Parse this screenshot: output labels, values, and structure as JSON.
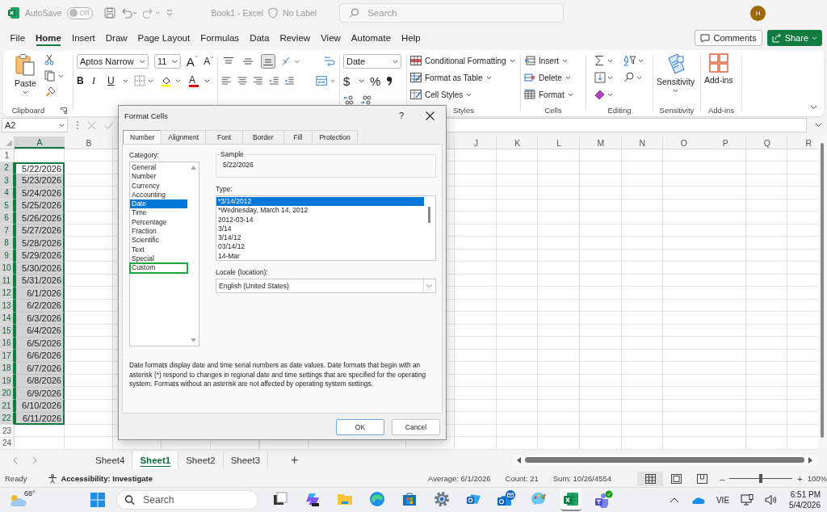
{
  "title_bar": {
    "autosave_label": "AutoSave",
    "autosave": {
      "on": false,
      "state_label": "Off"
    },
    "document_title": "Book1 - Excel",
    "sensitivity_label": "No Label",
    "search_placeholder": "Search",
    "avatar_initial": "H"
  },
  "menu_tabs": [
    {
      "label": "File",
      "selected": false
    },
    {
      "label": "Home",
      "selected": true
    },
    {
      "label": "Insert",
      "selected": false
    },
    {
      "label": "Draw",
      "selected": false
    },
    {
      "label": "Page Layout",
      "selected": false
    },
    {
      "label": "Formulas",
      "selected": false
    },
    {
      "label": "Data",
      "selected": false
    },
    {
      "label": "Review",
      "selected": false
    },
    {
      "label": "View",
      "selected": false
    },
    {
      "label": "Automate",
      "selected": false
    },
    {
      "label": "Help",
      "selected": false
    }
  ],
  "comments_button": "Comments",
  "share_button": "Share",
  "ribbon": {
    "clipboard": {
      "paste_label": "Paste",
      "group_label": "Clipboard"
    },
    "font": {
      "font_name": "Aptos Narrow",
      "font_size": "11",
      "grow_glyph": "A",
      "shrink_glyph": "A",
      "bold": "B",
      "italic": "I",
      "underline": "U",
      "font_color_glyph": "A"
    },
    "vertical_align": [
      {
        "kind": "top",
        "selected": false
      },
      {
        "kind": "middle",
        "selected": false
      },
      {
        "kind": "bottom",
        "selected": true
      }
    ],
    "number": {
      "format": "Date",
      "currency_glyph": "$",
      "percent_glyph": "%"
    },
    "styles": {
      "items": [
        {
          "kind": "conditional",
          "label": "Conditional Formatting"
        },
        {
          "kind": "table",
          "label": "Format as Table"
        },
        {
          "kind": "cell_styles",
          "label": "Cell Styles"
        }
      ],
      "group_label": "Styles"
    },
    "cells": {
      "items": [
        {
          "kind": "insert",
          "label": "Insert"
        },
        {
          "kind": "delete",
          "label": "Delete"
        },
        {
          "kind": "format",
          "label": "Format"
        }
      ],
      "group_label": "Cells"
    },
    "editing": {
      "group_label": "Editing"
    },
    "sensitivity": {
      "label": "Sensitivity",
      "group_label": "Sensitivity"
    },
    "addins": {
      "label": "Add-ins",
      "group_label": "Add-ins"
    }
  },
  "formula_bar": {
    "name_box": "A2"
  },
  "sheet": {
    "columns": [
      {
        "label": "A",
        "selected": true
      },
      {
        "label": "B",
        "selected": false
      },
      {
        "label": "J",
        "selected": false
      },
      {
        "label": "K",
        "selected": false
      },
      {
        "label": "L",
        "selected": false
      },
      {
        "label": "M",
        "selected": false
      },
      {
        "label": "N",
        "selected": false
      },
      {
        "label": "O",
        "selected": false
      },
      {
        "label": "P",
        "selected": false
      },
      {
        "label": "Q",
        "selected": false
      },
      {
        "label": "R",
        "selected": false
      }
    ],
    "rows": [
      {
        "number": "1",
        "selected": false
      },
      {
        "number": "2",
        "selected": true,
        "active": true,
        "value": "5/22/2026"
      },
      {
        "number": "3",
        "selected": true,
        "active": false,
        "value": "5/23/2026"
      },
      {
        "number": "4",
        "selected": true,
        "active": false,
        "value": "5/24/2026"
      },
      {
        "number": "5",
        "selected": true,
        "active": false,
        "value": "5/25/2026"
      },
      {
        "number": "6",
        "selected": true,
        "active": false,
        "value": "5/26/2026"
      },
      {
        "number": "7",
        "selected": true,
        "active": false,
        "value": "5/27/2026"
      },
      {
        "number": "8",
        "selected": true,
        "active": false,
        "value": "5/28/2026"
      },
      {
        "number": "9",
        "selected": true,
        "active": false,
        "value": "5/29/2026"
      },
      {
        "number": "10",
        "selected": true,
        "active": false,
        "value": "5/30/2026"
      },
      {
        "number": "11",
        "selected": true,
        "active": false,
        "value": "5/31/2026"
      },
      {
        "number": "12",
        "selected": true,
        "active": false,
        "value": "6/1/2026"
      },
      {
        "number": "13",
        "selected": true,
        "active": false,
        "value": "6/2/2026"
      },
      {
        "number": "14",
        "selected": true,
        "active": false,
        "value": "6/3/2026"
      },
      {
        "number": "15",
        "selected": true,
        "active": false,
        "value": "6/4/2026"
      },
      {
        "number": "16",
        "selected": true,
        "active": false,
        "value": "6/5/2026"
      },
      {
        "number": "17",
        "selected": true,
        "active": false,
        "value": "6/6/2026"
      },
      {
        "number": "18",
        "selected": true,
        "active": false,
        "value": "6/7/2026"
      },
      {
        "number": "19",
        "selected": true,
        "active": false,
        "value": "6/8/2026"
      },
      {
        "number": "20",
        "selected": true,
        "active": false,
        "value": "6/9/2026"
      },
      {
        "number": "21",
        "selected": true,
        "active": false,
        "value": "6/10/2026"
      },
      {
        "number": "22",
        "selected": true,
        "active": false,
        "value": "6/11/2026"
      },
      {
        "number": "23",
        "selected": false
      },
      {
        "number": "24",
        "selected": false
      }
    ]
  },
  "sheet_tabs": [
    {
      "label": "Sheet4",
      "selected": false
    },
    {
      "label": "Sheet1",
      "selected": true
    },
    {
      "label": "Sheet2",
      "selected": false
    },
    {
      "label": "Sheet3",
      "selected": false
    }
  ],
  "add_sheet": "+",
  "status_bar": {
    "ready": "Ready",
    "accessibility": "Accessibility: Investigate",
    "average": "Average: 6/1/2026",
    "count": "Count: 21",
    "sum": "Sum: 10/26/4554",
    "views": [
      {
        "kind": "normal",
        "selected": true
      },
      {
        "kind": "page_layout",
        "selected": false
      },
      {
        "kind": "page_break",
        "selected": false
      }
    ],
    "zoom_out": "–",
    "zoom_in": "+",
    "zoom": {
      "level": 0.5
    },
    "zoom_label": "100%"
  },
  "taskbar": {
    "temperature": "68°",
    "search_placeholder": "Search",
    "apps": [
      {
        "kind": "task_view",
        "active": false
      },
      {
        "kind": "copilot",
        "active": false
      },
      {
        "kind": "file_explorer",
        "active": false
      },
      {
        "kind": "edge",
        "active": false
      },
      {
        "kind": "store",
        "active": false
      },
      {
        "kind": "settings",
        "active": false
      },
      {
        "kind": "outlook_new",
        "active": false
      },
      {
        "kind": "outlook",
        "active": false
      },
      {
        "kind": "paint",
        "active": false
      },
      {
        "kind": "excel",
        "active": true
      },
      {
        "kind": "teams",
        "active": false
      }
    ],
    "language": "VIE",
    "time": "6:51 PM",
    "date": "5/4/2026"
  },
  "dialog": {
    "title": "Format Cells",
    "help": "?",
    "tabs": [
      {
        "label": "Number",
        "selected": true
      },
      {
        "label": "Alignment",
        "selected": false
      },
      {
        "label": "Font",
        "selected": false
      },
      {
        "label": "Border",
        "selected": false
      },
      {
        "label": "Fill",
        "selected": false
      },
      {
        "label": "Protection",
        "selected": false
      }
    ],
    "category_label": "Category:",
    "categories": [
      {
        "label": "General",
        "selected": false,
        "highlighted": false
      },
      {
        "label": "Number",
        "selected": false,
        "highlighted": false
      },
      {
        "label": "Currency",
        "selected": false,
        "highlighted": false
      },
      {
        "label": "Accounting",
        "selected": false,
        "highlighted": false
      },
      {
        "label": "Date",
        "selected": true,
        "highlighted": false
      },
      {
        "label": "Time",
        "selected": false,
        "highlighted": false
      },
      {
        "label": "Percentage",
        "selected": false,
        "highlighted": false
      },
      {
        "label": "Fraction",
        "selected": false,
        "highlighted": false
      },
      {
        "label": "Scientific",
        "selected": false,
        "highlighted": false
      },
      {
        "label": "Text",
        "selected": false,
        "highlighted": false
      },
      {
        "label": "Special",
        "selected": false,
        "highlighted": false
      },
      {
        "label": "Custom",
        "selected": false,
        "highlighted": true
      }
    ],
    "sample_label": "Sample",
    "sample_value": "5/22/2026",
    "type_label": "Type:",
    "types": [
      {
        "label": "*3/14/2012",
        "selected": true
      },
      {
        "label": "*Wednesday, March 14, 2012",
        "selected": false
      },
      {
        "label": "2012-03-14",
        "selected": false
      },
      {
        "label": "3/14",
        "selected": false
      },
      {
        "label": "3/14/12",
        "selected": false
      },
      {
        "label": "03/14/12",
        "selected": false
      },
      {
        "label": "14-Mar",
        "selected": false
      }
    ],
    "locale_label": "Locale (location):",
    "locale_value": "English (United States)",
    "description": "Date formats display date and time serial numbers as date values.  Date formats that begin with an asterisk (*) respond to changes in regional date and time settings that are specified for the operating system. Formats without an asterisk are not affected by operating system settings.",
    "ok": "OK",
    "cancel": "Cancel"
  }
}
